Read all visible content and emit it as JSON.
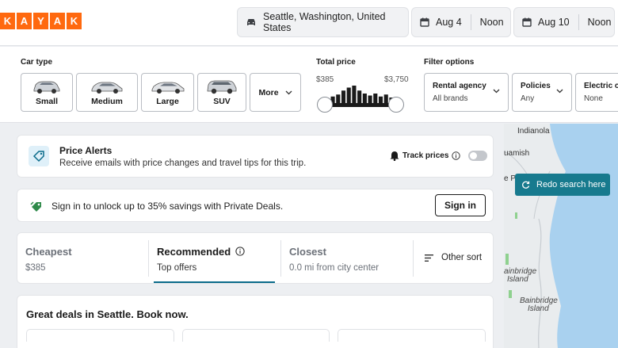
{
  "logo": {
    "letters": [
      "K",
      "A",
      "Y",
      "A",
      "K"
    ]
  },
  "search": {
    "location": "Seattle, Washington, United States",
    "pickup_date": "Aug 4",
    "pickup_time": "Noon",
    "dropoff_date": "Aug 10",
    "dropoff_time": "Noon",
    "location_icon": "car-icon",
    "date_icon": "calendar-icon"
  },
  "filters": {
    "car_type_label": "Car type",
    "car_types": [
      {
        "label": "Small"
      },
      {
        "label": "Medium"
      },
      {
        "label": "Large"
      },
      {
        "label": "SUV"
      }
    ],
    "more_label": "More",
    "total_price_label": "Total price",
    "price_min": "$385",
    "price_max": "$3,750",
    "price_histogram": [
      0.35,
      0.45,
      0.55,
      0.75,
      0.9,
      1.0,
      0.75,
      0.6,
      0.5,
      0.6,
      0.45,
      0.55,
      0.4,
      0.3
    ],
    "filter_options_label": "Filter options",
    "dropdowns": [
      {
        "title": "Rental agency",
        "value": "All brands"
      },
      {
        "title": "Policies",
        "value": "Any"
      },
      {
        "title": "Electric c",
        "value": "None"
      }
    ]
  },
  "price_alerts": {
    "title": "Price Alerts",
    "subtitle": "Receive emails with price changes and travel tips for this trip.",
    "track_label": "Track prices"
  },
  "private_deals": {
    "text": "Sign in to unlock up to 35% savings with Private Deals.",
    "button": "Sign in"
  },
  "sort_tabs": [
    {
      "name": "Cheapest",
      "sub": "$385"
    },
    {
      "name": "Recommended",
      "sub": "Top offers"
    },
    {
      "name": "Closest",
      "sub": "0.0 mi from city center"
    }
  ],
  "other_sort": "Other sort",
  "deals": {
    "title": "Great deals in Seattle. Book now."
  },
  "map": {
    "labels": [
      "Indianola",
      "uamish",
      "e Pa",
      "ainbridge",
      "Island",
      "Bainbridge",
      "Island"
    ],
    "redo_button": "Redo search here",
    "water_color": "#a9d1ef",
    "land_color": "#e9ecee"
  },
  "colors": {
    "brand": "#ff690f",
    "accent": "#0a6b8a",
    "map_button": "#177a8e"
  }
}
